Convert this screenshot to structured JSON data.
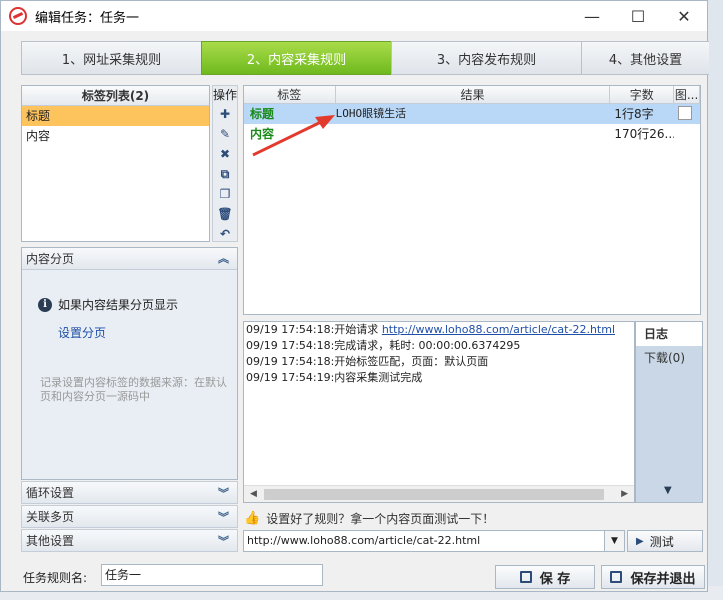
{
  "window": {
    "title": "编辑任务：任务一",
    "controls": {
      "minimize": "—",
      "maximize": "☐",
      "close": "✕"
    }
  },
  "steps": [
    {
      "label": "1、网址采集规则",
      "active": false
    },
    {
      "label": "2、内容采集规则",
      "active": true
    },
    {
      "label": "3、内容发布规则",
      "active": false
    },
    {
      "label": "4、其他设置",
      "active": false
    }
  ],
  "tag_list": {
    "header": "标签列表(2)",
    "items": [
      "标题",
      "内容"
    ],
    "selected_index": 0
  },
  "ops": {
    "header": "操作",
    "buttons": [
      "✚",
      "✎",
      "✖",
      "⧉",
      "❐",
      "🗑",
      "↶"
    ]
  },
  "pagination": {
    "header": "内容分页",
    "info": "如果内容结果分页显示",
    "link": "设置分页",
    "hint": "记录设置内容标签的数据来源：在默认页和内容分页一源码中"
  },
  "accordion": [
    "循环设置",
    "关联多页",
    "其他设置"
  ],
  "result_table": {
    "columns": [
      "标签",
      "结果",
      "字数",
      "图..."
    ],
    "rows": [
      {
        "tag": "标题",
        "result": "LOHO眼镜生活",
        "count": "1行8字"
      },
      {
        "tag": "内容",
        "result": "",
        "count": "170行26..."
      }
    ]
  },
  "log": {
    "lines": [
      {
        "text": "09/19 17:54:18:开始请求 ",
        "url": "http://www.loho88.com/article/cat-22.html"
      },
      {
        "text": "09/19 17:54:18:完成请求，耗时: 00:00:00.6374295",
        "url": ""
      },
      {
        "text": "09/19 17:54:18:开始标签匹配，页面：默认页面",
        "url": ""
      },
      {
        "text": "09/19 17:54:19:内容采集测试完成",
        "url": ""
      }
    ],
    "tabs": [
      "日志",
      "下载(0)"
    ]
  },
  "test": {
    "tip": "设置好了规则？拿一个内容页面测试一下！",
    "url": "http://www.loho88.com/article/cat-22.html",
    "button": "测试"
  },
  "footer": {
    "name_label": "任务规则名:",
    "name_value": "任务一",
    "save": "保 存",
    "save_exit": "保存并退出"
  },
  "colors": {
    "accent_green": "#7cc52a",
    "selection": "#fdc45e",
    "link": "#1f4fa8"
  }
}
